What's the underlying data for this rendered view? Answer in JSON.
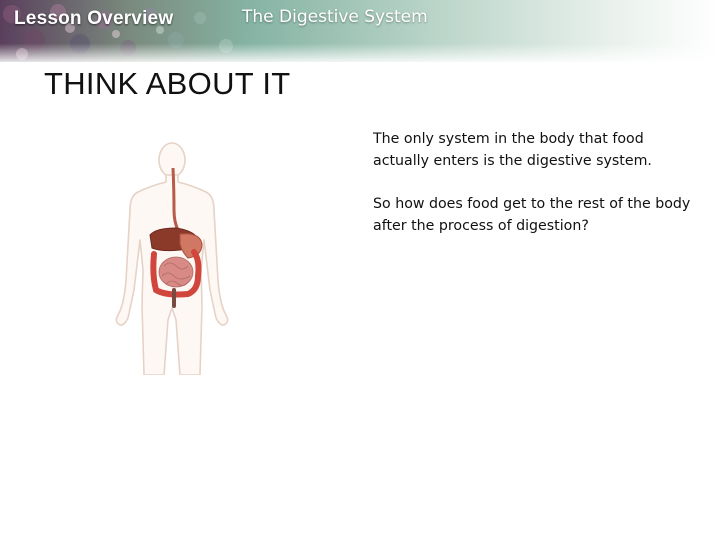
{
  "header": {
    "section_label": "Lesson Overview",
    "lesson_title": "The Digestive System",
    "accent_color": "#6a9a8a"
  },
  "slide": {
    "heading": "THINK ABOUT IT",
    "paragraphs": [
      "The only system in the body that food actually enters is the digestive system.",
      "So how does food get to the rest of the body after the process of digestion?"
    ]
  },
  "figure": {
    "icon": "human-digestive-system-illustration"
  }
}
